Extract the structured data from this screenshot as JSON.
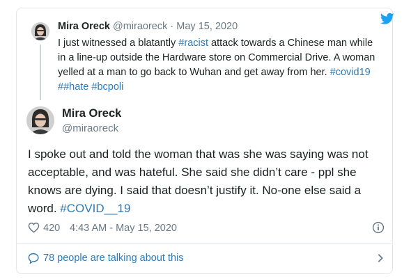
{
  "quoted_tweet": {
    "author_name": "Mira Oreck",
    "author_handle": "@miraoreck",
    "separator": "·",
    "date": "May 15, 2020",
    "text_parts": [
      {
        "text": "I just witnessed a blatantly ",
        "tag": false
      },
      {
        "text": "#racist",
        "tag": true
      },
      {
        "text": " attack towards a Chinese man while in a line-up outside the Hardware store on Commercial Drive. A woman yelled at a man to go back to Wuhan and get away from her. ",
        "tag": false
      },
      {
        "text": "#covid19",
        "tag": true
      },
      {
        "text": " ##hate",
        "tag": true
      },
      {
        "text": " ",
        "tag": false
      },
      {
        "text": "#bcpoli",
        "tag": true
      }
    ]
  },
  "main_tweet": {
    "author_name": "Mira Oreck",
    "author_handle": "@miraoreck",
    "text_parts": [
      {
        "text": "I spoke out and told the woman that was she was saying was not acceptable, and was hateful. She said she didn’t care - ppl she knows are dying. I said that doesn’t justify it. No-one else said a word. ",
        "tag": false
      },
      {
        "text": "#COVID__19",
        "tag": true
      }
    ],
    "like_count": "420",
    "timestamp": "4:43 AM - May 15, 2020"
  },
  "footer": {
    "talking_label": "78 people are talking about this"
  },
  "icons": {
    "brand": "twitter-bird-icon",
    "like": "heart-icon",
    "info": "info-icon",
    "conversation": "speech-bubble-icon",
    "navigate": "chevron-right-icon"
  },
  "colors": {
    "link": "#2b7bb9",
    "muted": "#697882",
    "text": "#1c2022",
    "border": "#e1e8ed",
    "twitter_blue": "#1da1f2"
  }
}
